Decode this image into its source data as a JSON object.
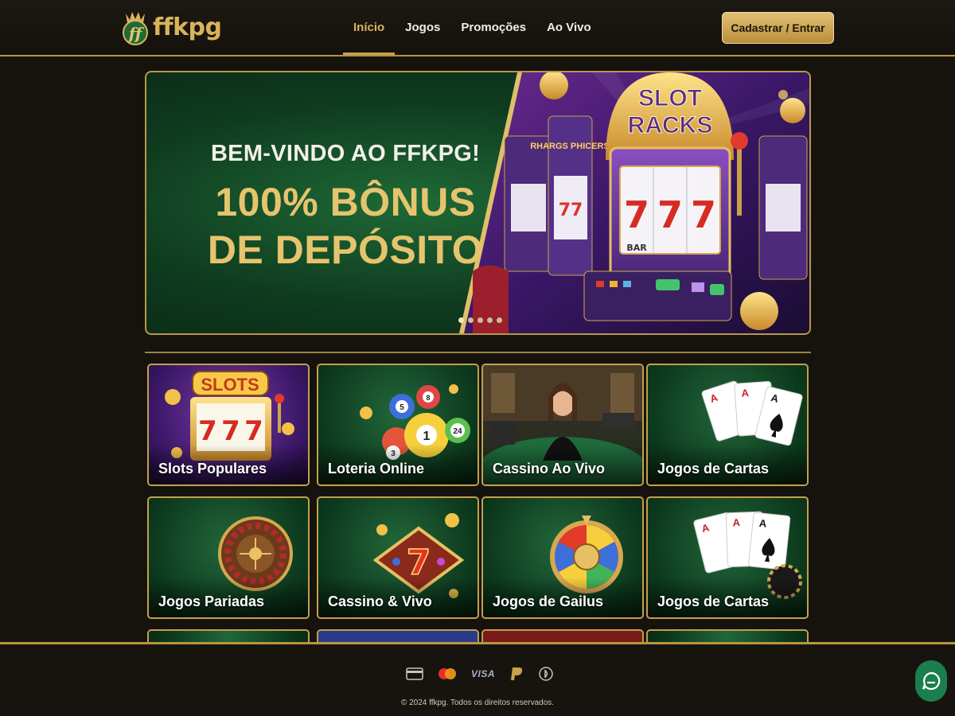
{
  "header": {
    "logo_text": "ffkpg",
    "nav": [
      {
        "label": "Início",
        "active": true
      },
      {
        "label": "Jogos",
        "active": false
      },
      {
        "label": "Promoções",
        "active": false
      },
      {
        "label": "Ao Vivo",
        "active": false
      }
    ],
    "cta_label": "Cadastrar / Entrar"
  },
  "hero": {
    "subtitle": "BEM-VINDO AO FFKPG!",
    "title_line1": "100% BÔNUS",
    "title_line2": "DE DEPÓSITO",
    "machine_sign": "SLOT RACKS",
    "machine_sign_line1": "SLOT",
    "machine_sign_line2": "RACKS",
    "side_sign": "RHARGS PHICERS",
    "reel_symbols": [
      "7",
      "7",
      "7"
    ],
    "reel_footer": "BAR",
    "carousel_dots": 5,
    "active_dot": 0
  },
  "tiles": [
    {
      "label": "Slots Populares",
      "icon": "slot-machine-icon",
      "sign": "SLOTS",
      "reels": [
        "7",
        "7",
        "7"
      ]
    },
    {
      "label": "Loteria Online",
      "icon": "lottery-balls-icon",
      "balls": [
        "5",
        "1",
        "24",
        "3",
        "8"
      ]
    },
    {
      "label": "Cassino Ao Vivo",
      "icon": "live-dealer-icon"
    },
    {
      "label": "Jogos de Cartas",
      "icon": "playing-cards-icon",
      "cards": [
        "A",
        "A",
        "A"
      ]
    },
    {
      "label": "Jogos Pariadas",
      "icon": "roulette-icon"
    },
    {
      "label": "Cassino & Vivo",
      "icon": "lucky-seven-icon",
      "symbol": "7"
    },
    {
      "label": "Jogos de Gailus",
      "icon": "prize-wheel-icon"
    },
    {
      "label": "Jogos de Cartas",
      "icon": "cards-and-chip-icon",
      "cards": [
        "A",
        "A",
        "A"
      ]
    }
  ],
  "footer": {
    "payments": [
      "card-icon",
      "mastercard-icon",
      "visa-icon",
      "paypal-icon",
      "crypto-coin-icon"
    ],
    "visa_text": "VISA",
    "copyright": "© 2024 ffkpg. Todos os direitos reservados."
  },
  "colors": {
    "gold": "#d9b35b",
    "green": "#0f3b1f",
    "background": "#16130f",
    "chat": "#1b7e4e"
  }
}
